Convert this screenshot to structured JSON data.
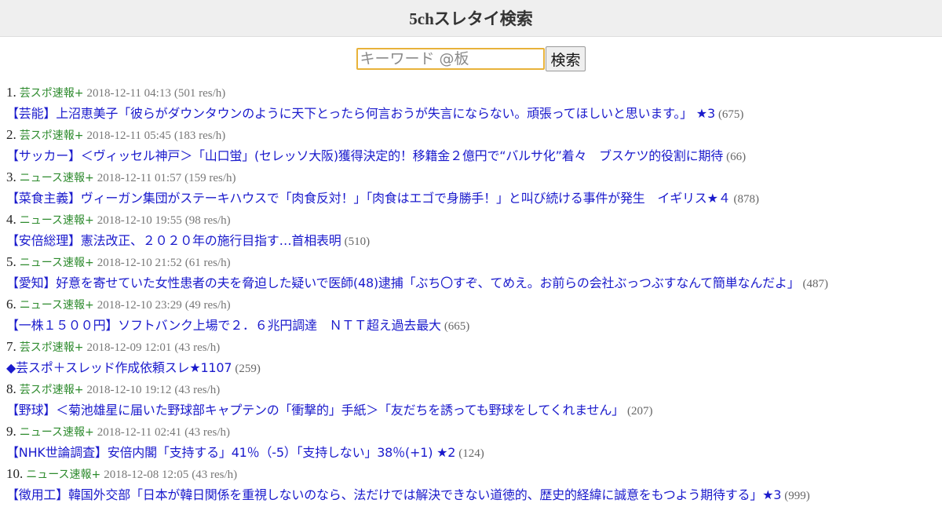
{
  "header": {
    "title": "5chスレタイ検索"
  },
  "search": {
    "placeholder": "キーワード @板",
    "button_label": "検索"
  },
  "results": [
    {
      "num": "1.",
      "board": "芸スポ速報+",
      "timestamp": "2018-12-11 04:13",
      "res": "(501 res/h)",
      "title": "【芸能】上沼恵美子「彼らがダウンタウンのように天下とったら何言おうが失言にならない。頑張ってほしいと思います。」 ★3",
      "count": "(675)"
    },
    {
      "num": "2.",
      "board": "芸スポ速報+",
      "timestamp": "2018-12-11 05:45",
      "res": "(183 res/h)",
      "title": "【サッカー】＜ヴィッセル神戸＞「山口蛍」(セレッソ大阪)獲得決定的！移籍金２億円で“バルサ化”着々　ブスケツ的役割に期待",
      "count": "(66)"
    },
    {
      "num": "3.",
      "board": "ニュース速報+",
      "timestamp": "2018-12-11 01:57",
      "res": "(159 res/h)",
      "title": "【菜食主義】ヴィーガン集団がステーキハウスで「肉食反対！」「肉食はエゴで身勝手！」と叫び続ける事件が発生　イギリス★４",
      "count": "(878)"
    },
    {
      "num": "4.",
      "board": "ニュース速報+",
      "timestamp": "2018-12-10 19:55",
      "res": "(98 res/h)",
      "title": "【安倍総理】憲法改正、２０２０年の施行目指す…首相表明",
      "count": "(510)"
    },
    {
      "num": "5.",
      "board": "ニュース速報+",
      "timestamp": "2018-12-10 21:52",
      "res": "(61 res/h)",
      "title": "【愛知】好意を寄せていた女性患者の夫を脅迫した疑いで医師(48)逮捕「ぶち〇すぞ、てめえ。お前らの会社ぶっつぶすなんて簡単なんだよ」",
      "count": "(487)"
    },
    {
      "num": "6.",
      "board": "ニュース速報+",
      "timestamp": "2018-12-10 23:29",
      "res": "(49 res/h)",
      "title": "【一株１５００円】ソフトバンク上場で２．６兆円調達　ＮＴＴ超え過去最大",
      "count": "(665)"
    },
    {
      "num": "7.",
      "board": "芸スポ速報+",
      "timestamp": "2018-12-09 12:01",
      "res": "(43 res/h)",
      "title": "◆芸スポ＋スレッド作成依頼スレ★1107",
      "count": "(259)"
    },
    {
      "num": "8.",
      "board": "芸スポ速報+",
      "timestamp": "2018-12-10 19:12",
      "res": "(43 res/h)",
      "title": "【野球】＜菊池雄星に届いた野球部キャプテンの「衝撃的」手紙＞「友だちを誘っても野球をしてくれません」",
      "count": "(207)"
    },
    {
      "num": "9.",
      "board": "ニュース速報+",
      "timestamp": "2018-12-11 02:41",
      "res": "(43 res/h)",
      "title": "【NHK世論調査】安倍内閣「支持する」41％（-5）「支持しない」38％(+1) ★2",
      "count": "(124)"
    },
    {
      "num": "10.",
      "board": "ニュース速報+",
      "timestamp": "2018-12-08 12:05",
      "res": "(43 res/h)",
      "title": "【徴用工】韓国外交部「日本が韓日関係を重視しないのなら、法だけでは解決できない道徳的、歴史的経緯に誠意をもつよう期待する」★3",
      "count": "(999)"
    }
  ],
  "colors": {
    "header_bg": "#efefef",
    "link": "#1a1acc",
    "board": "#2e8b2e",
    "meta": "#777777",
    "input_border": "#e8b23a"
  }
}
